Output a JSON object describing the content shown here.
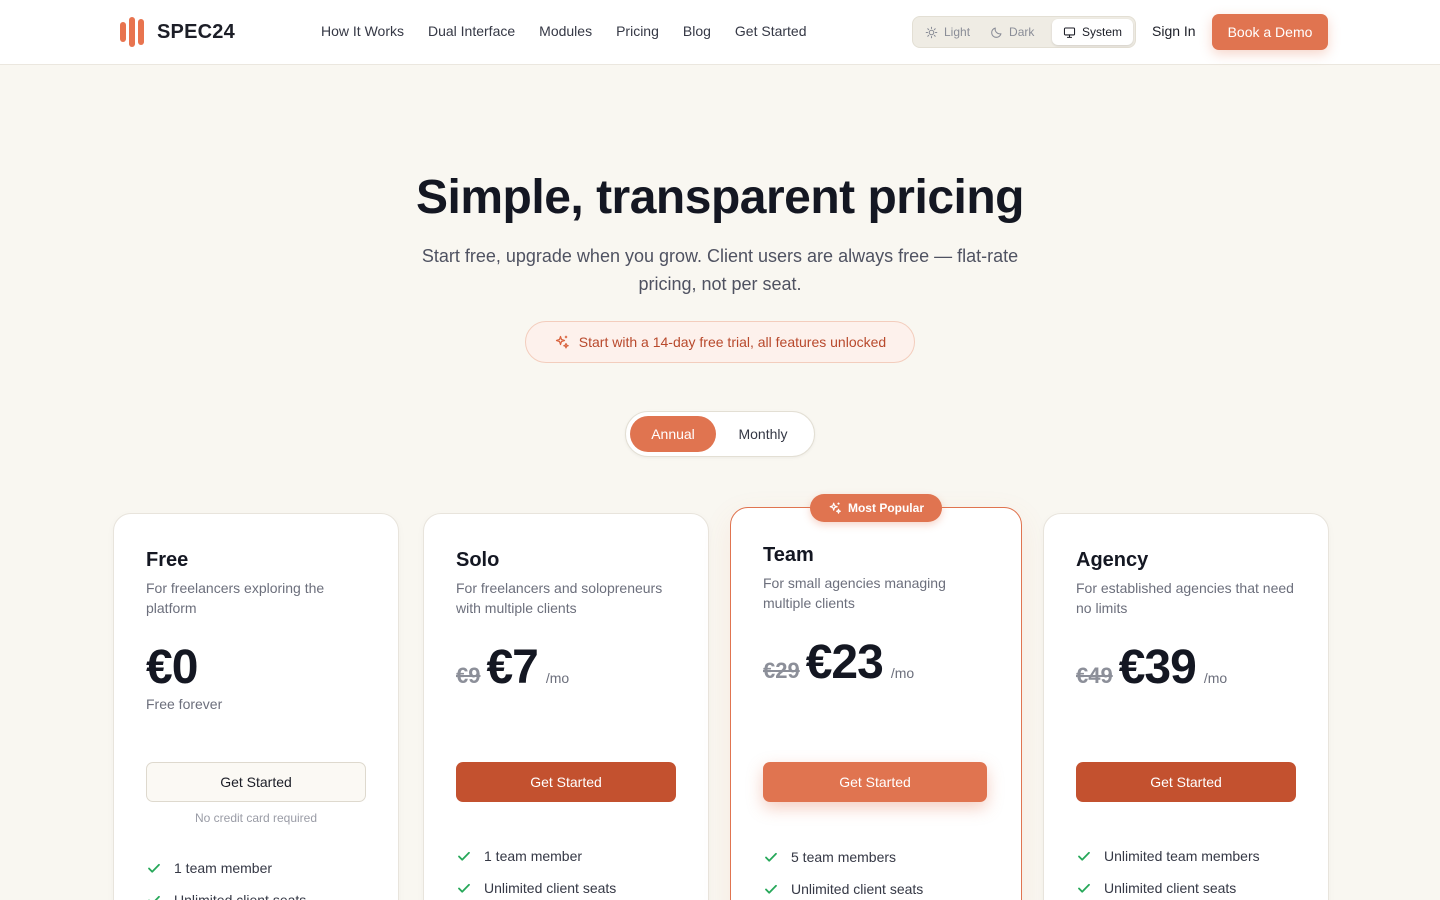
{
  "brand": {
    "name": "SPEC24",
    "accent": "#e07450",
    "accent_dark": "#c3512f",
    "check_color": "#27a85a"
  },
  "nav": [
    "How It Works",
    "Dual Interface",
    "Modules",
    "Pricing",
    "Blog",
    "Get Started"
  ],
  "theme": {
    "light": "Light",
    "dark": "Dark",
    "system": "System",
    "selected": "System"
  },
  "header": {
    "signin": "Sign In",
    "demo": "Book a Demo"
  },
  "hero": {
    "title": "Simple, transparent pricing",
    "subtitle": "Start free, upgrade when you grow. Client users are always free — flat-rate pricing, not per seat.",
    "trial": "Start with a 14-day free trial, all features unlocked"
  },
  "billing": {
    "annual": "Annual",
    "monthly": "Monthly",
    "selected": "Annual"
  },
  "plans": [
    {
      "name": "Free",
      "description": "For freelancers exploring the platform",
      "old_price": "",
      "price": "€0",
      "period": "",
      "note": "Free forever",
      "cta": "Get Started",
      "cta_note": "No credit card required",
      "features": [
        "1 team member",
        "Unlimited client seats"
      ]
    },
    {
      "name": "Solo",
      "description": "For freelancers and solopreneurs with multiple clients",
      "old_price": "€9",
      "price": "€7",
      "period": "/mo",
      "cta": "Get Started",
      "features": [
        "1 team member",
        "Unlimited client seats"
      ]
    },
    {
      "name": "Team",
      "badge": "Most Popular",
      "description": "For small agencies managing multiple clients",
      "old_price": "€29",
      "price": "€23",
      "period": "/mo",
      "cta": "Get Started",
      "features": [
        "5 team members",
        "Unlimited client seats"
      ]
    },
    {
      "name": "Agency",
      "description": "For established agencies that need no limits",
      "old_price": "€49",
      "price": "€39",
      "period": "/mo",
      "cta": "Get Started",
      "features": [
        "Unlimited team members",
        "Unlimited client seats"
      ]
    }
  ]
}
